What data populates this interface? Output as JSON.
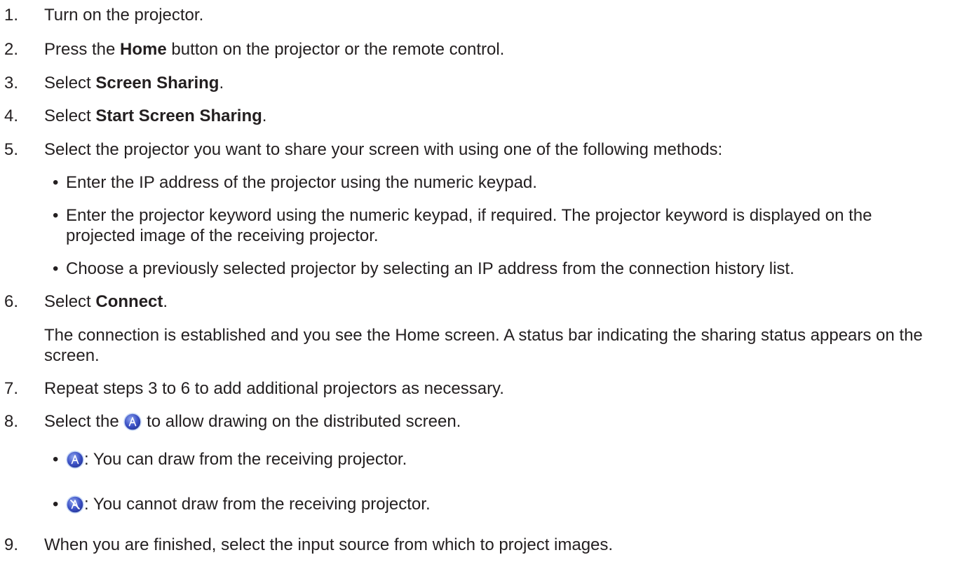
{
  "steps": [
    {
      "num": "1.",
      "text": "Turn on the projector."
    },
    {
      "num": "2.",
      "pre": "Press the ",
      "bold": "Home",
      "post": " button on the projector or the remote control."
    },
    {
      "num": "3.",
      "pre": "Select ",
      "bold": "Screen Sharing",
      "post": "."
    },
    {
      "num": "4.",
      "pre": "Select ",
      "bold": "Start Screen Sharing",
      "post": "."
    },
    {
      "num": "5.",
      "text": "Select the projector you want to share your screen with using one of the following methods:"
    },
    {
      "num": "6.",
      "pre": "Select ",
      "bold": "Connect",
      "post": "."
    },
    {
      "num": "7.",
      "text": "Repeat steps 3 to 6 to add additional projectors as necessary."
    },
    {
      "num": "8.",
      "pre": "Select the ",
      "post": " to allow drawing on the distributed screen."
    },
    {
      "num": "9.",
      "text": "When you are finished, select the input source from which to project images."
    }
  ],
  "step5_bullets": [
    "Enter the IP address of the projector using the numeric keypad.",
    "Enter the projector keyword using the numeric keypad, if required. The projector keyword is displayed on the projected image of the receiving projector.",
    "Choose a previously selected projector by selecting an IP address from the connection history list."
  ],
  "step6_note": "The connection is established and you see the Home screen. A status bar indicating the sharing status appears on the screen.",
  "step8_bullets": [
    ": You can draw from the receiving projector.",
    ": You cannot draw from the receiving projector."
  ],
  "bullet_char": "•",
  "icons": {
    "draw_allowed": "drawing-allowed-icon",
    "draw_disallowed": "drawing-disallowed-icon"
  },
  "colors": {
    "text": "#231f20",
    "icon_blue": "#3a4fc4",
    "icon_light": "#c9daf5"
  }
}
